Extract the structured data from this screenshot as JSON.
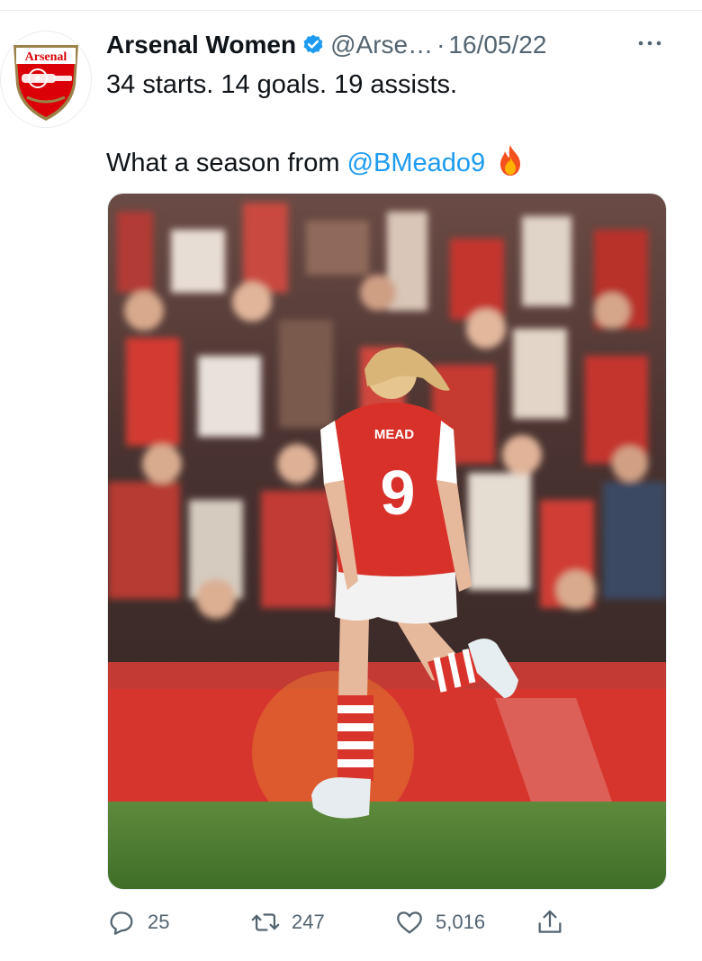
{
  "tweet": {
    "author": {
      "display_name": "Arsenal Women",
      "handle": "@Arse…",
      "avatar_icon": "arsenal-crest-icon",
      "avatar_text": "Arsenal",
      "verified_icon": "verified-badge-icon"
    },
    "separator": "·",
    "date": "16/05/22",
    "text_line1": "34 starts. 14 goals. 19 assists.",
    "text_line2_prefix": "What a season from ",
    "mention": "@BMeado9",
    "emoji_icon": "fire-icon",
    "media": {
      "jersey_name": "MEAD",
      "jersey_number": "9"
    },
    "actions": {
      "reply": {
        "icon": "reply-icon",
        "count": "25"
      },
      "retweet": {
        "icon": "retweet-icon",
        "count": "247"
      },
      "like": {
        "icon": "heart-icon",
        "count": "5,016"
      },
      "share": {
        "icon": "share-icon"
      }
    },
    "more_icon": "more-options-icon"
  },
  "colors": {
    "accent": "#1d9bf0",
    "text": "#0f1419",
    "muted": "#536471",
    "arsenal_red": "#db0007"
  }
}
